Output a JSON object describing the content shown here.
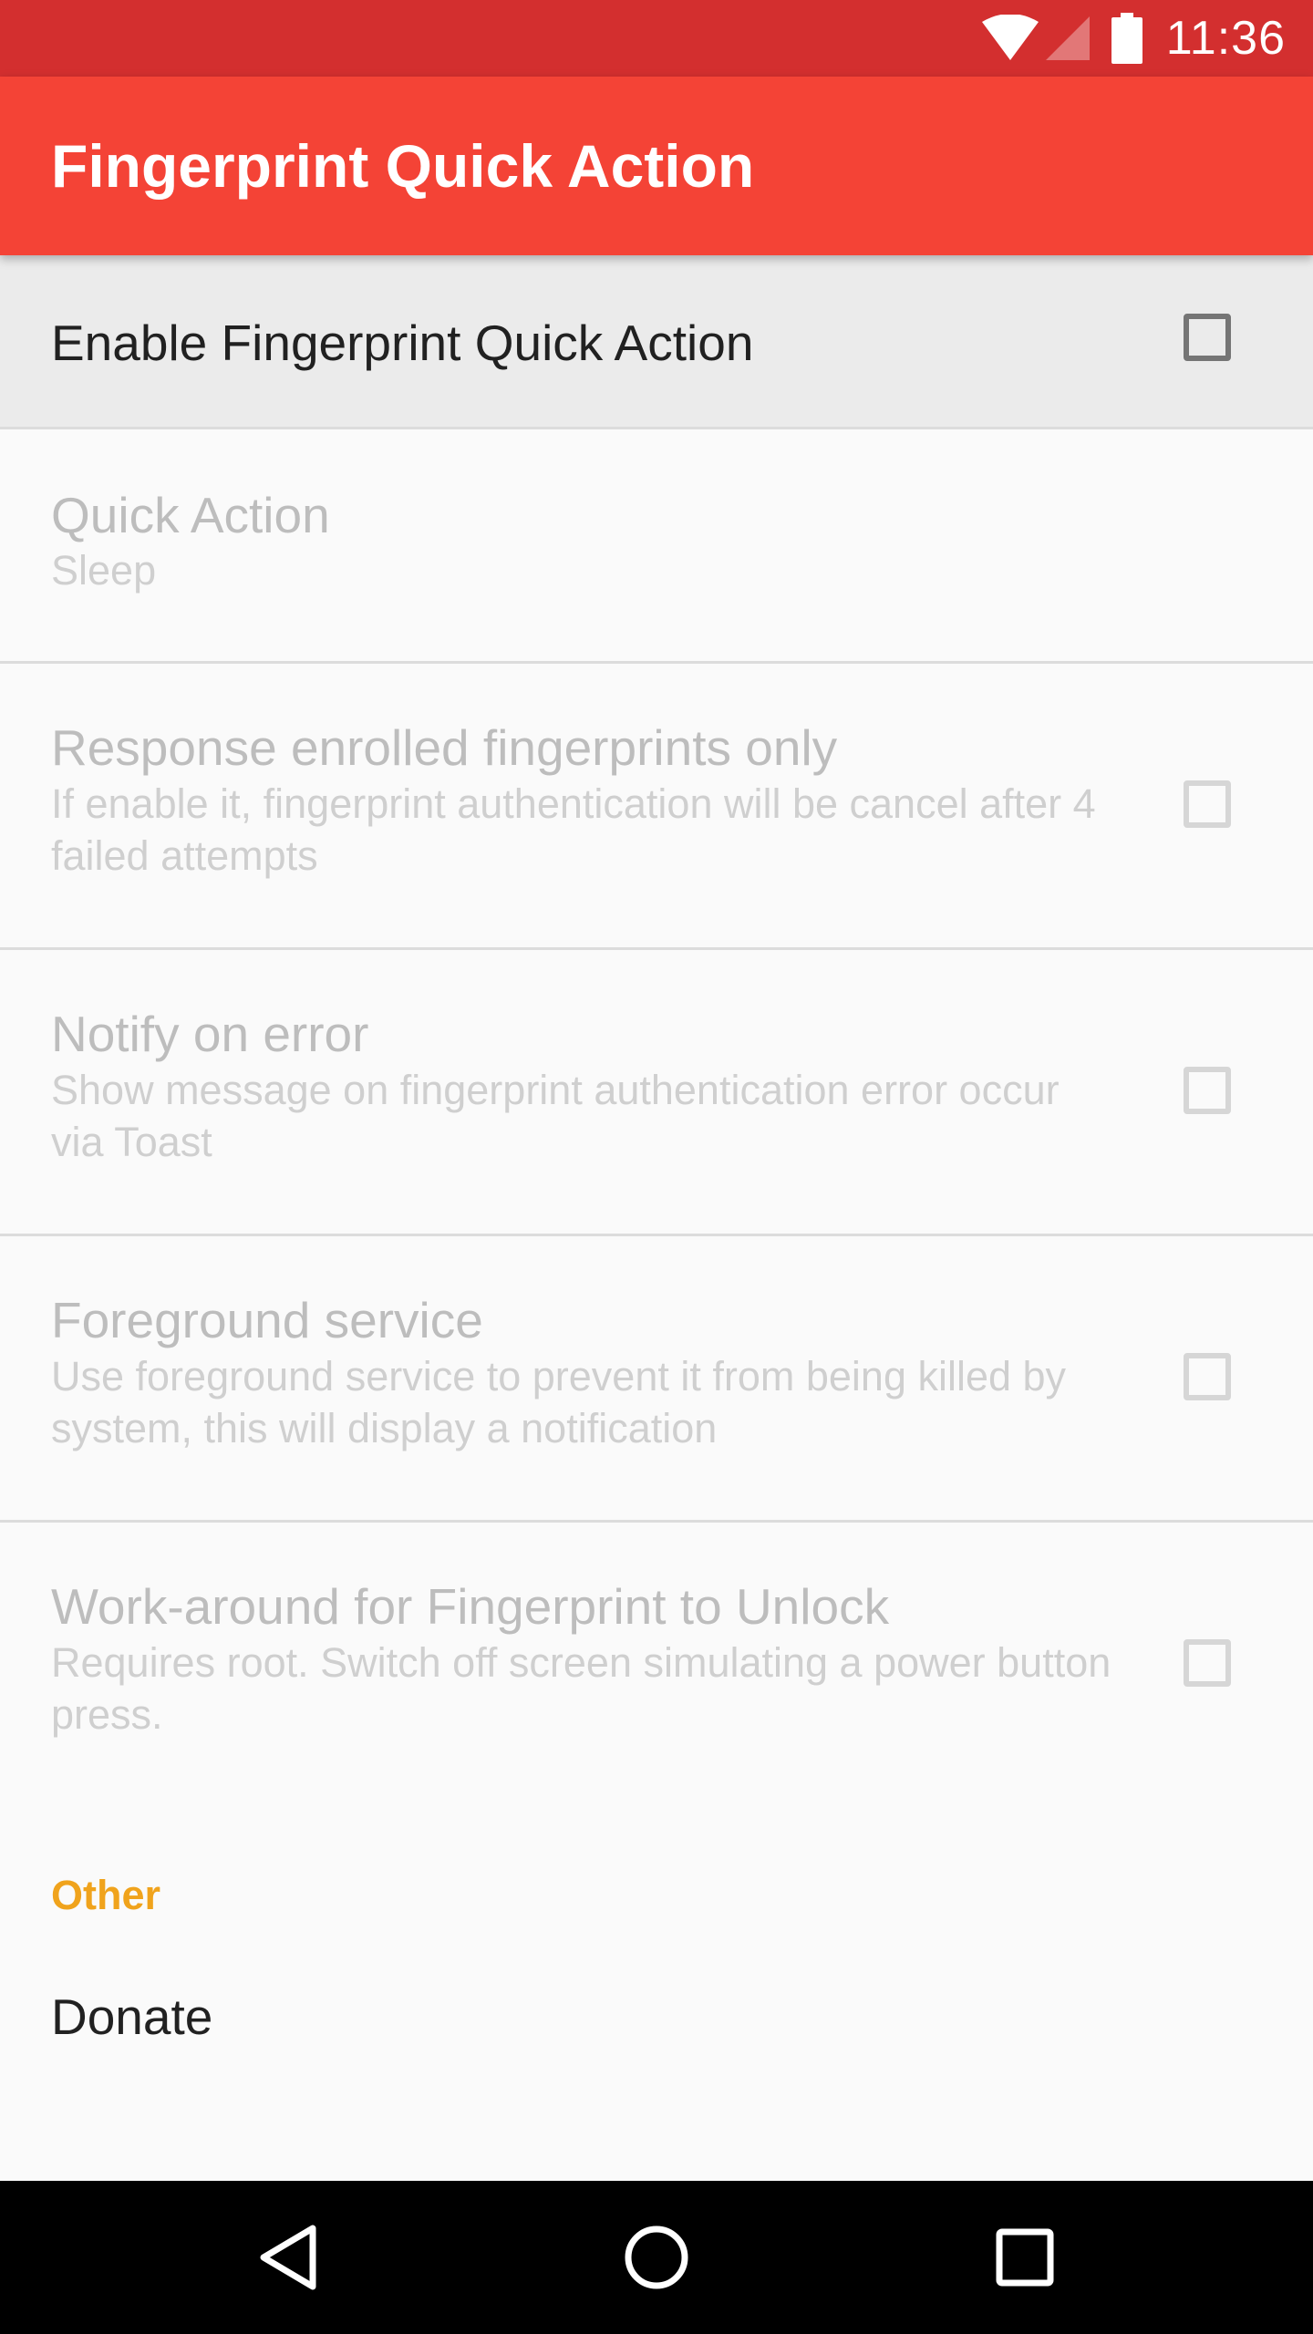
{
  "status_bar": {
    "time": "11:36",
    "icons": [
      "wifi-icon",
      "signal-icon",
      "battery-icon"
    ],
    "color": "#d32f2f"
  },
  "app_bar": {
    "title": "Fingerprint Quick Action",
    "color": "#f44336"
  },
  "master_switch": {
    "label": "Enable Fingerprint Quick Action",
    "checked": false
  },
  "preferences": [
    {
      "title": "Quick Action",
      "summary": "Sleep",
      "enabled": false
    },
    {
      "title": "Response enrolled fingerprints only",
      "summary": "If enable it, fingerprint authentication will be cancel after 4 failed attempts",
      "checked": false,
      "enabled": false
    },
    {
      "title": "Notify on error",
      "summary": "Show message on fingerprint authentication error occur via Toast",
      "checked": false,
      "enabled": false
    },
    {
      "title": "Foreground service",
      "summary": "Use foreground service to prevent it from being killed by system, this will display a notification",
      "checked": false,
      "enabled": false
    },
    {
      "title": "Work-around for Fingerprint to Unlock",
      "summary": "Requires root. Switch off screen simulating a power button press.",
      "checked": false,
      "enabled": false
    }
  ],
  "other_section": {
    "header": "Other",
    "header_color": "#f0a31c",
    "items": [
      {
        "title": "Donate"
      }
    ]
  },
  "nav_bar": {
    "buttons": [
      "back-icon",
      "home-icon",
      "recents-icon"
    ]
  }
}
